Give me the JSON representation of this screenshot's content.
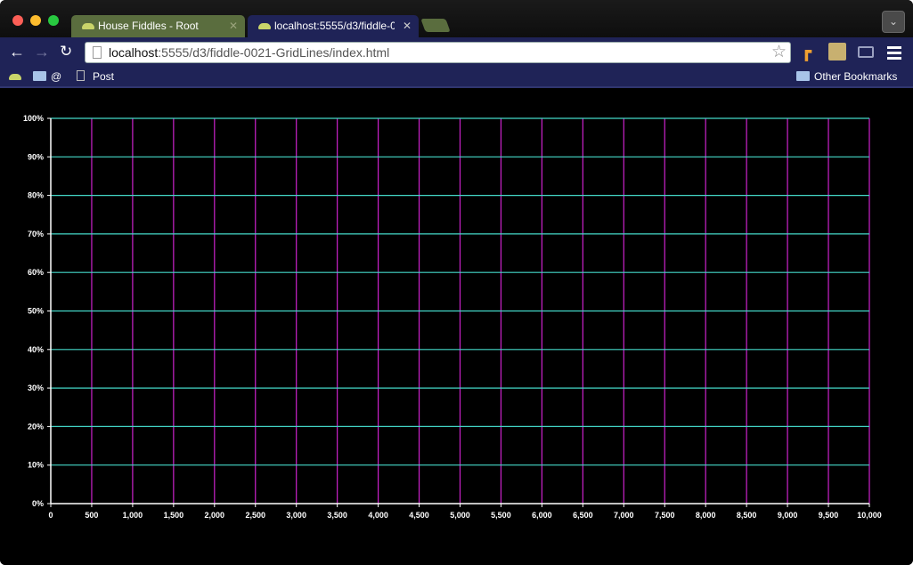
{
  "window": {
    "tabs": [
      {
        "title": "House Fiddles - Root",
        "active": false
      },
      {
        "title": "localhost:5555/d3/fiddle-0021-GridLines/index.html",
        "active": true
      }
    ]
  },
  "toolbar": {
    "back_icon": "arrow-left-icon",
    "forward_icon": "arrow-right-icon",
    "reload_icon": "reload-icon",
    "url_host": "localhost",
    "url_path": ":5555/d3/fiddle-0021-GridLines/index.html",
    "bookmark_star_icon": "star-icon",
    "menu_icon": "hamburger-menu-icon"
  },
  "bookmarks": {
    "items": [
      {
        "label": "",
        "icon": "favicon"
      },
      {
        "label": "@",
        "icon": "folder-icon"
      },
      {
        "label": "Post",
        "icon": "page-icon"
      }
    ],
    "other_label": "Other Bookmarks"
  },
  "colors": {
    "vertical_grid": "#cc22cc",
    "horizontal_grid": "#44d8c8",
    "axis": "#ffffff",
    "background": "#000000",
    "toolbar": "#1f2357"
  },
  "chart_data": {
    "type": "line",
    "title": "",
    "xlabel": "",
    "ylabel": "",
    "xlim": [
      0,
      10000
    ],
    "ylim": [
      0,
      1
    ],
    "grid": true,
    "x_ticks": [
      0,
      500,
      1000,
      1500,
      2000,
      2500,
      3000,
      3500,
      4000,
      4500,
      5000,
      5500,
      6000,
      6500,
      7000,
      7500,
      8000,
      8500,
      9000,
      9500,
      10000
    ],
    "x_tick_labels": [
      "0",
      "500",
      "1,000",
      "1,500",
      "2,000",
      "2,500",
      "3,000",
      "3,500",
      "4,000",
      "4,500",
      "5,000",
      "5,500",
      "6,000",
      "6,500",
      "7,000",
      "7,500",
      "8,000",
      "8,500",
      "9,000",
      "9,500",
      "10,000"
    ],
    "y_ticks": [
      0,
      0.1,
      0.2,
      0.3,
      0.4,
      0.5,
      0.6,
      0.7,
      0.8,
      0.9,
      1.0
    ],
    "y_tick_labels": [
      "0%",
      "10%",
      "20%",
      "30%",
      "40%",
      "50%",
      "60%",
      "70%",
      "80%",
      "90%",
      "100%"
    ],
    "series": []
  }
}
